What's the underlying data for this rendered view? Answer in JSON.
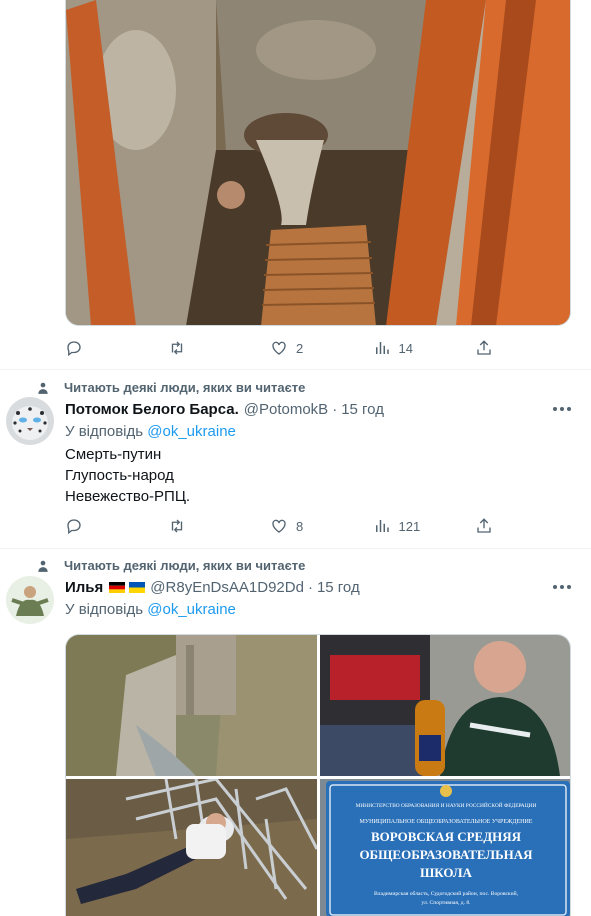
{
  "tweet1": {
    "media_alt": "Photo of a dilapidated toilet",
    "actions": {
      "reply_count": "",
      "retweet_count": "",
      "like_count": "2",
      "views_count": "14"
    }
  },
  "tweet2": {
    "social_context": "Читають деякі люди, яких ви читаєте",
    "author_name": "Потомок Белого Барса.",
    "author_handle": "@PotomokB",
    "separator": "·",
    "timestamp": "15 год",
    "reply_prefix": "У відповідь",
    "reply_to": "@ok_ukraine",
    "text_lines": [
      "Смерть-путин",
      "Глупость-народ",
      "Невежество-РПЦ."
    ],
    "actions": {
      "reply_count": "",
      "retweet_count": "",
      "like_count": "8",
      "views_count": "121"
    }
  },
  "tweet3": {
    "social_context": "Читають деякі люди, яких ви читаєте",
    "author_name": "Илья",
    "author_flags": [
      "flag-germany-icon",
      "flag-ukraine-icon"
    ],
    "author_handle": "@R8yEnDsAA1D92Dd",
    "separator": "·",
    "timestamp": "15 год",
    "reply_prefix": "У відповідь",
    "reply_to": "@ok_ukraine",
    "sign_text": {
      "ministry": "МИНИСТЕРСТВО ОБРАЗОВАНИЯ И НАУКИ РОССИЙСКОЙ ФЕДЕРАЦИИ",
      "org": "МУНИЦИПАЛЬНОЕ ОБЩЕОБРАЗОВАТЕЛЬНОЕ УЧРЕЖДЕНИЕ",
      "line1": "ВОРОВСКАЯ СРЕДНЯЯ",
      "line2": "ОБЩЕОБРАЗОВАТЕЛЬНАЯ",
      "line3": "ШКОЛА",
      "addr1": "Владимирская область, Судогодский район, пос. Воровский,",
      "addr2": "ул. Спортивная, д. 8."
    }
  },
  "colors": {
    "accent": "#1d9bf0",
    "muted": "#536471",
    "text": "#0f1419",
    "divider": "#eff3f4"
  }
}
